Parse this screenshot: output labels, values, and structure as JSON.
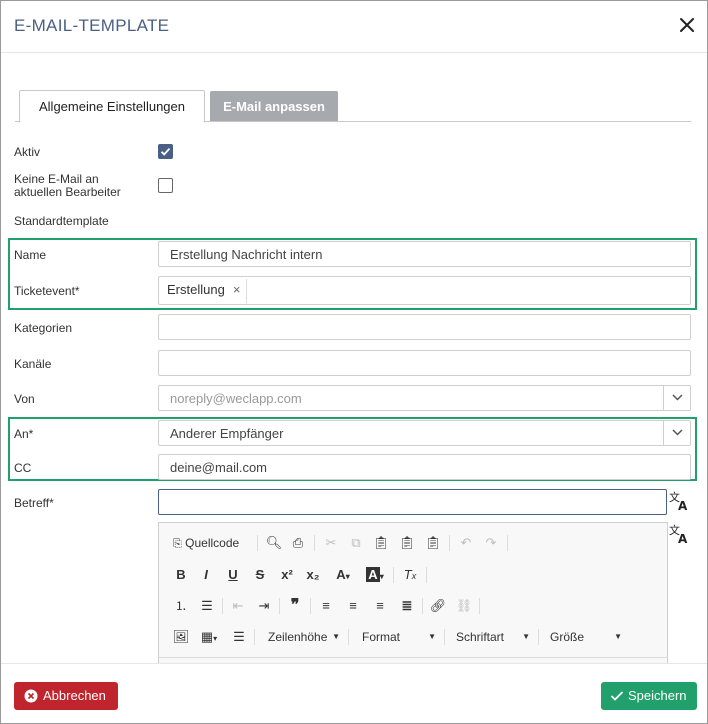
{
  "dialog": {
    "title": "E-MAIL-TEMPLATE"
  },
  "tabs": [
    {
      "label": "Allgemeine Einstellungen"
    },
    {
      "label": "E-Mail anpassen"
    }
  ],
  "form": {
    "aktiv": {
      "label": "Aktiv",
      "checked": true
    },
    "keine_email": {
      "label_line1": "Keine E-Mail an",
      "label_line2": "aktuellen Bearbeiter",
      "checked": false
    },
    "standardtemplate": {
      "label": "Standardtemplate"
    },
    "name": {
      "label": "Name",
      "value": "Erstellung Nachricht intern"
    },
    "ticketevent": {
      "label": "Ticketevent*",
      "chip": "Erstellung",
      "chip_remove": "×"
    },
    "kategorien": {
      "label": "Kategorien",
      "value": ""
    },
    "kanaele": {
      "label": "Kanäle",
      "value": ""
    },
    "von": {
      "label": "Von",
      "value": "noreply@weclapp.com"
    },
    "an": {
      "label": "An*",
      "value": "Anderer Empfänger"
    },
    "cc": {
      "label": "CC",
      "value": "deine@mail.com"
    },
    "betreff": {
      "label": "Betreff*",
      "value": ""
    }
  },
  "editor": {
    "source_label": "Quellcode",
    "zeilenhoehe": "Zeilenhöhe",
    "format": "Format",
    "schriftart": "Schriftart",
    "groesse": "Größe"
  },
  "footer": {
    "cancel_label": "Abbrechen",
    "save_label": "Speichern"
  },
  "colors": {
    "title": "#4a5f85",
    "highlight": "#22a06b",
    "cancel": "#c0242d",
    "save": "#22a06b",
    "checkbox": "#4a5f85"
  }
}
